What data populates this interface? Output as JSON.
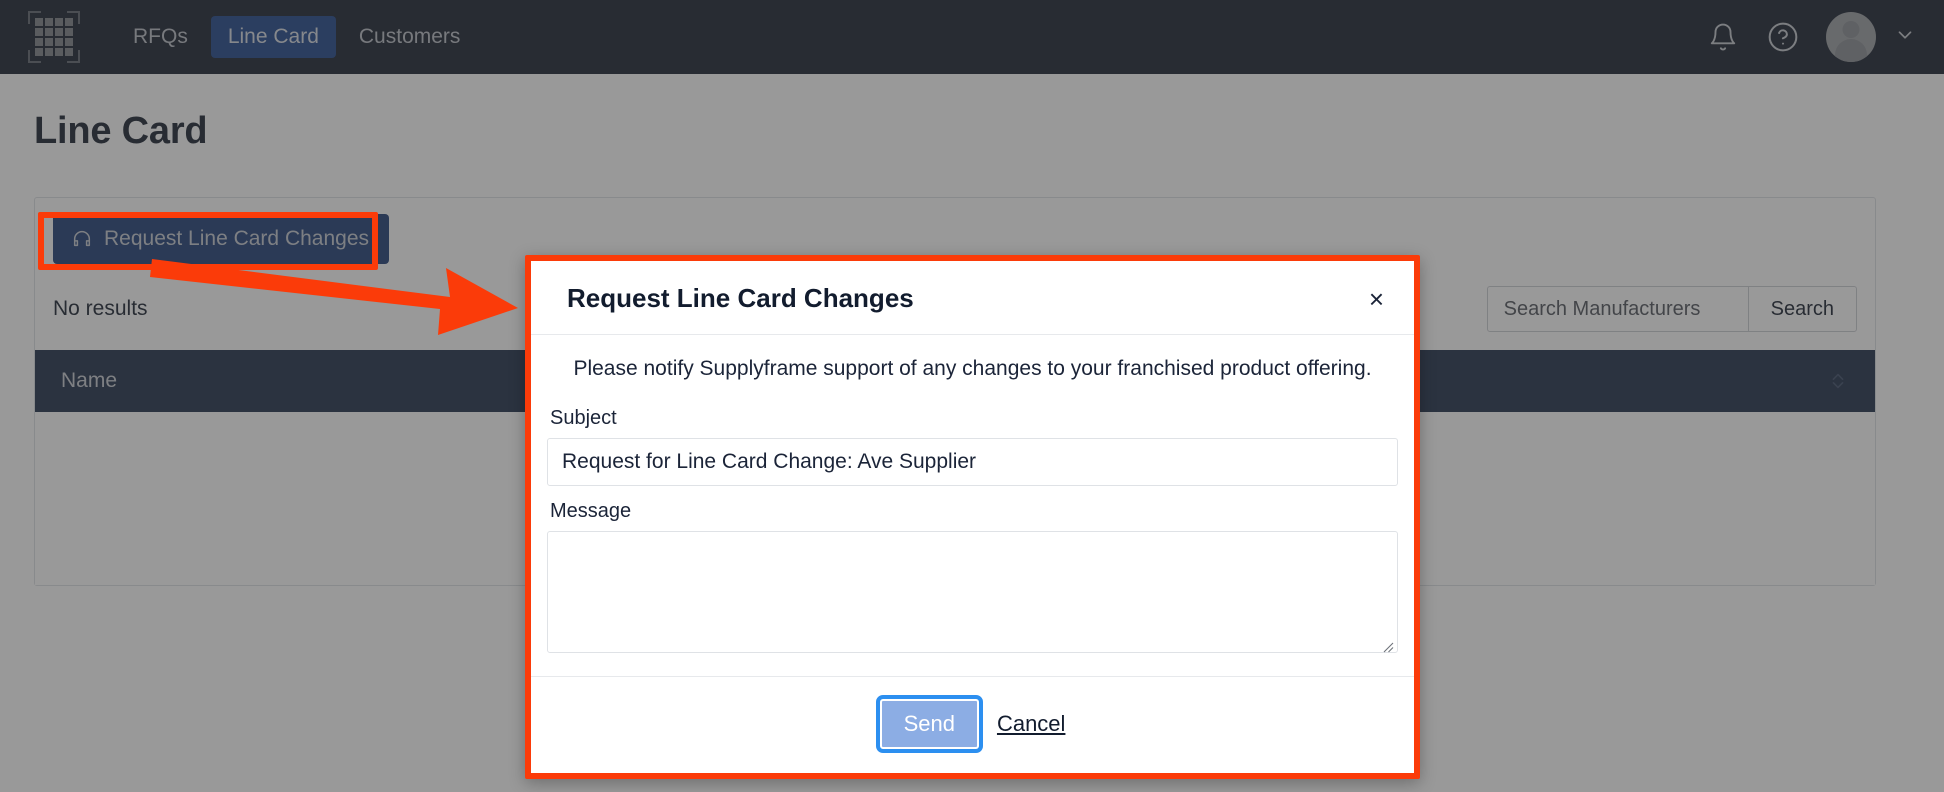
{
  "topnav": {
    "logo_name": "grid-logo",
    "items": [
      {
        "label": "RFQs",
        "active": false
      },
      {
        "label": "Line Card",
        "active": true
      },
      {
        "label": "Customers",
        "active": false
      }
    ],
    "notifications_icon": "bell-icon",
    "help_icon": "help-circle-icon",
    "avatar_icon": "user-avatar",
    "caret_icon": "chevron-down-icon",
    "background": "#131c2b",
    "active_tab_color": "#194289"
  },
  "page": {
    "title": "Line Card"
  },
  "toolbar": {
    "request_button_label": "Request Line Card Changes",
    "request_button_icon": "headset-support-icon",
    "request_button_color": "#1a3a73"
  },
  "results": {
    "status_text": "No results"
  },
  "search": {
    "placeholder": "Search Manufacturers",
    "value": "",
    "button_label": "Search"
  },
  "table": {
    "columns": [
      {
        "label": "Name",
        "sort_icon": "sort-updown-icon"
      }
    ],
    "rows": [],
    "header_background": "#1b2a45"
  },
  "modal": {
    "title": "Request Line Card Changes",
    "close_icon": "close-x-icon",
    "close_label": "×",
    "note": "Please notify Supplyframe support of any changes to your franchised product offering.",
    "subject_label": "Subject",
    "subject_value": "Request for Line Card Change: Ave Supplier",
    "subject_placeholder": "",
    "message_label": "Message",
    "message_value": "",
    "message_placeholder": "",
    "send_label": "Send",
    "cancel_label": "Cancel",
    "send_button_color": "#8cade4",
    "focus_ring_color": "#2c8ff0"
  },
  "annotations": {
    "highlight_color": "#fb3b09",
    "highlight_target": "Request Line Card Changes",
    "arrow_from": "request-line-card-changes-button",
    "arrow_to": "request-line-card-changes-modal"
  }
}
